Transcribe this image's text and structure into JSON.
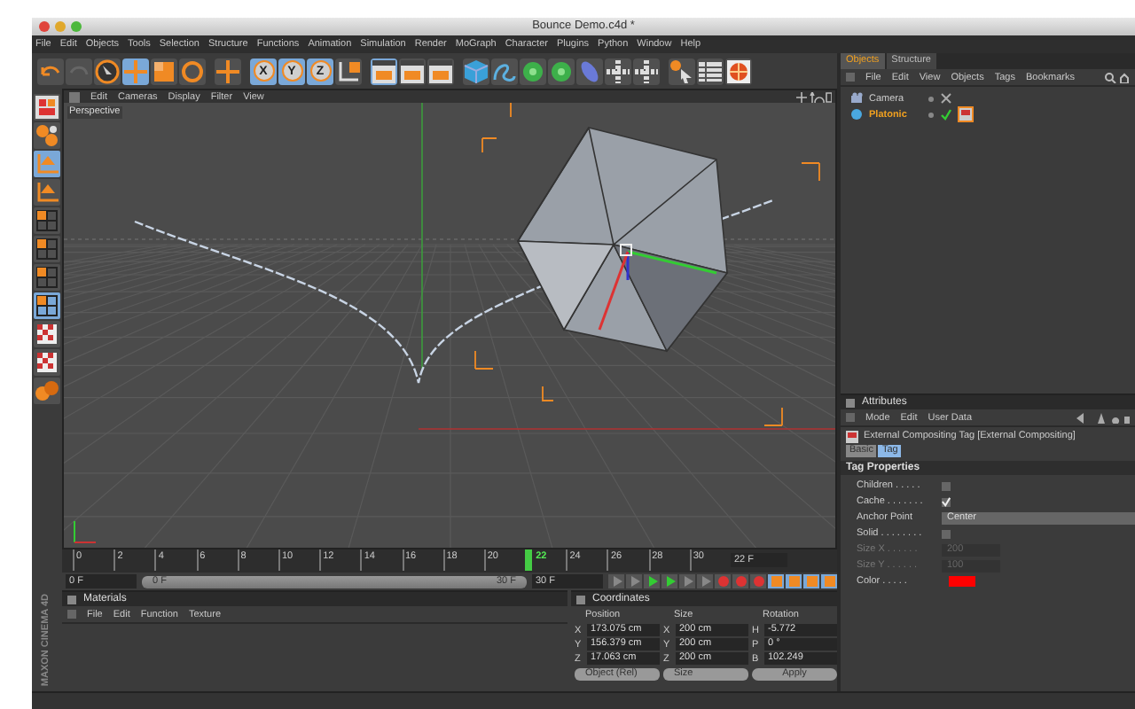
{
  "window": {
    "title": "Bounce Demo.c4d *"
  },
  "menu": [
    "File",
    "Edit",
    "Objects",
    "Tools",
    "Selection",
    "Structure",
    "Functions",
    "Animation",
    "Simulation",
    "Render",
    "MoGraph",
    "Character",
    "Plugins",
    "Python",
    "Window",
    "Help"
  ],
  "toolbar": [
    {
      "kind": "undo",
      "selected": false
    },
    {
      "kind": "redo",
      "selected": false
    },
    {
      "kind": "select",
      "selected": false
    },
    {
      "kind": "move",
      "selected": true
    },
    {
      "kind": "scale",
      "selected": false
    },
    {
      "kind": "rotate",
      "selected": false
    },
    {
      "kind": "move",
      "selected": false
    },
    {
      "kind": "letter",
      "label": "X",
      "selected": true
    },
    {
      "kind": "letter",
      "label": "Y",
      "selected": true
    },
    {
      "kind": "letter",
      "label": "Z",
      "selected": true
    },
    {
      "kind": "coord",
      "selected": false
    },
    {
      "kind": "render",
      "selected": true
    },
    {
      "kind": "render",
      "selected": false
    },
    {
      "kind": "render",
      "selected": false
    },
    {
      "kind": "cube",
      "selected": false
    },
    {
      "kind": "spline",
      "selected": false
    },
    {
      "kind": "nurbs",
      "selected": false
    },
    {
      "kind": "nurbs",
      "selected": false
    },
    {
      "kind": "deformer",
      "selected": false
    },
    {
      "kind": "scene",
      "selected": false
    },
    {
      "kind": "scene",
      "selected": false
    },
    {
      "kind": "help",
      "selected": false
    },
    {
      "kind": "table",
      "selected": false
    },
    {
      "kind": "globe",
      "selected": false
    }
  ],
  "left_tools": [
    {
      "kind": "layout",
      "selected": false
    },
    {
      "kind": "points",
      "selected": false
    },
    {
      "kind": "axis",
      "selected": true
    },
    {
      "kind": "axis",
      "selected": false
    },
    {
      "kind": "grid",
      "selected": false
    },
    {
      "kind": "grid",
      "selected": false
    },
    {
      "kind": "grid",
      "selected": false
    },
    {
      "kind": "grid",
      "selected": true
    },
    {
      "kind": "checker",
      "selected": false
    },
    {
      "kind": "checker",
      "selected": false
    },
    {
      "kind": "spheres",
      "selected": false
    }
  ],
  "viewport": {
    "menu": [
      "Edit",
      "Cameras",
      "Display",
      "Filter",
      "View"
    ],
    "label": "Perspective"
  },
  "timeline": {
    "ticks": [
      {
        "label": "0",
        "selected": false
      },
      {
        "label": "2",
        "selected": false
      },
      {
        "label": "4",
        "selected": false
      },
      {
        "label": "6",
        "selected": false
      },
      {
        "label": "8",
        "selected": false
      },
      {
        "label": "10",
        "selected": false
      },
      {
        "label": "12",
        "selected": false
      },
      {
        "label": "14",
        "selected": false
      },
      {
        "label": "16",
        "selected": false
      },
      {
        "label": "18",
        "selected": false
      },
      {
        "label": "20",
        "selected": false
      },
      {
        "label": "22",
        "selected": true
      },
      {
        "label": "24",
        "selected": false
      },
      {
        "label": "26",
        "selected": false
      },
      {
        "label": "28",
        "selected": false
      },
      {
        "label": "30",
        "selected": false
      }
    ],
    "level": 1,
    "current_field": "22 F",
    "start_field": "0 F",
    "range_start": "0 F",
    "range_end": "30 F",
    "end_field": "30 F"
  },
  "materials": {
    "title": "Materials",
    "menu": [
      "File",
      "Edit",
      "Function",
      "Texture"
    ]
  },
  "coordinates": {
    "title": "Coordinates",
    "headers": [
      "Position",
      "Size",
      "Rotation"
    ],
    "rows": [
      {
        "axis": "X",
        "position": "173.075 cm",
        "size_axis": "X",
        "size": "200 cm",
        "rot_axis": "H",
        "rotation": "-5.772"
      },
      {
        "axis": "Y",
        "position": "156.379 cm",
        "size_axis": "Y",
        "size": "200 cm",
        "rot_axis": "P",
        "rotation": "0 °"
      },
      {
        "axis": "Z",
        "position": "17.063 cm",
        "size_axis": "Z",
        "size": "200 cm",
        "rot_axis": "B",
        "rotation": "102.249"
      }
    ],
    "mode": "Object (Rel)",
    "size_mode": "Size",
    "apply": "Apply"
  },
  "branding": "MAXON CINEMA 4D",
  "objects_panel": {
    "tabs": [
      {
        "label": "Objects",
        "selected": true
      },
      {
        "label": "Structure",
        "selected": false
      }
    ],
    "menu": [
      "File",
      "Edit",
      "View",
      "Objects",
      "Tags",
      "Bookmarks"
    ],
    "items": [
      {
        "name": "Camera",
        "kind": "camera",
        "selected": false,
        "enabled": false
      },
      {
        "name": "Platonic",
        "kind": "platonic",
        "selected": true,
        "enabled": true
      }
    ]
  },
  "attributes": {
    "title": "Attributes",
    "menu": [
      "Mode",
      "Edit",
      "User Data"
    ],
    "object": "External Compositing Tag [External Compositing]",
    "tabs": [
      {
        "label": "Basic",
        "selected": false
      },
      {
        "label": "Tag",
        "selected": true
      }
    ],
    "section": "Tag Properties",
    "props": [
      {
        "kind": "checkbox",
        "label": "Children . . . . .",
        "checked": false
      },
      {
        "kind": "checkbox",
        "label": "Cache . . . . . . .",
        "checked": true
      },
      {
        "kind": "dropdown",
        "label": "Anchor Point",
        "value": "Center"
      },
      {
        "kind": "checkbox",
        "label": "Solid . . . . . . . .",
        "checked": false
      },
      {
        "kind": "number",
        "label": "Size X . . . . . .",
        "value": "200",
        "disabled": true
      },
      {
        "kind": "number",
        "label": "Size Y . . . . . .",
        "value": "100",
        "disabled": true
      },
      {
        "kind": "color",
        "label": "Color . . . . .",
        "color": "#ff0000"
      }
    ]
  }
}
